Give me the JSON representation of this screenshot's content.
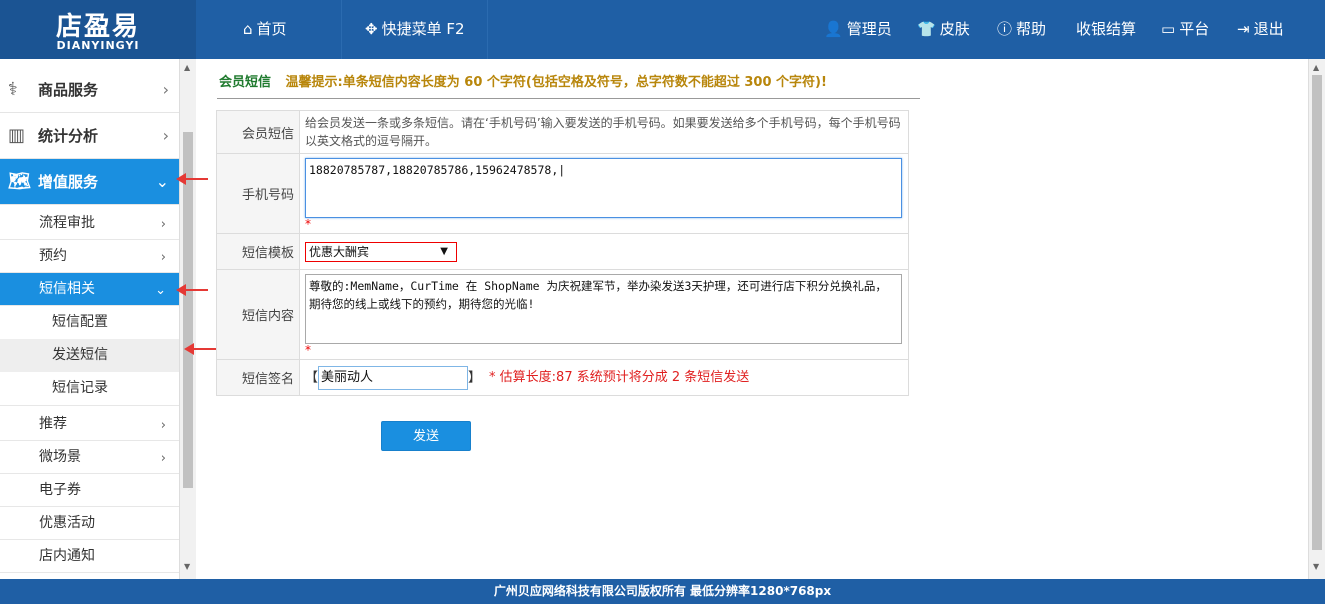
{
  "brand": {
    "name_cn": "店盈易",
    "name_en": "DIANYINGYI"
  },
  "topnav": {
    "home": "首页",
    "quick_menu": "快捷菜单 F2",
    "admin": "管理员",
    "skin": "皮肤",
    "help": "帮助",
    "checkout": "收银结算",
    "platform": "平台",
    "logout": "退出"
  },
  "sidebar": {
    "product_service": "商品服务",
    "stats": "统计分析",
    "value_added": "增值服务",
    "sub": {
      "process_approval": "流程审批",
      "appointment": "预约",
      "sms_related": "短信相关",
      "sms_config": "短信配置",
      "send_sms": "发送短信",
      "sms_log": "短信记录",
      "recommend": "推荐",
      "micro_scene": "微场景",
      "e_coupon": "电子券",
      "promotion": "优惠活动",
      "store_notice": "店内通知"
    }
  },
  "hint": {
    "title": "会员短信",
    "text": "温馨提示:单条短信内容长度为 60 个字符(包括空格及符号，总字符数不能超过 300 个字符)!"
  },
  "form": {
    "member_sms_label": "会员短信",
    "member_sms_desc": "给会员发送一条或多条短信。请在‘手机号码’输入要发送的手机号码。如果要发送给多个手机号码，每个手机号码以英文格式的逗号隔开。",
    "phone_label": "手机号码",
    "phone_value": "18820785787,18820785786,15962478578,|",
    "required_mark": "*",
    "template_label": "短信模板",
    "template_value": "优惠大酬宾",
    "content_label": "短信内容",
    "content_value": "尊敬的:MemName，CurTime 在 ShopName 为庆祝建军节，举办染发送3天护理，还可进行店下积分兑换礼品，期待您的线上或线下的预约，期待您的光临!",
    "signature_label": "短信签名",
    "bracket_open": "【",
    "bracket_close": "】",
    "signature_value": "美丽动人",
    "estimate": "* 估算长度:87 系统预计将分成 2 条短信发送"
  },
  "send_button": "发送",
  "footer": "广州贝应网络科技有限公司版权所有 最低分辨率1280*768px"
}
